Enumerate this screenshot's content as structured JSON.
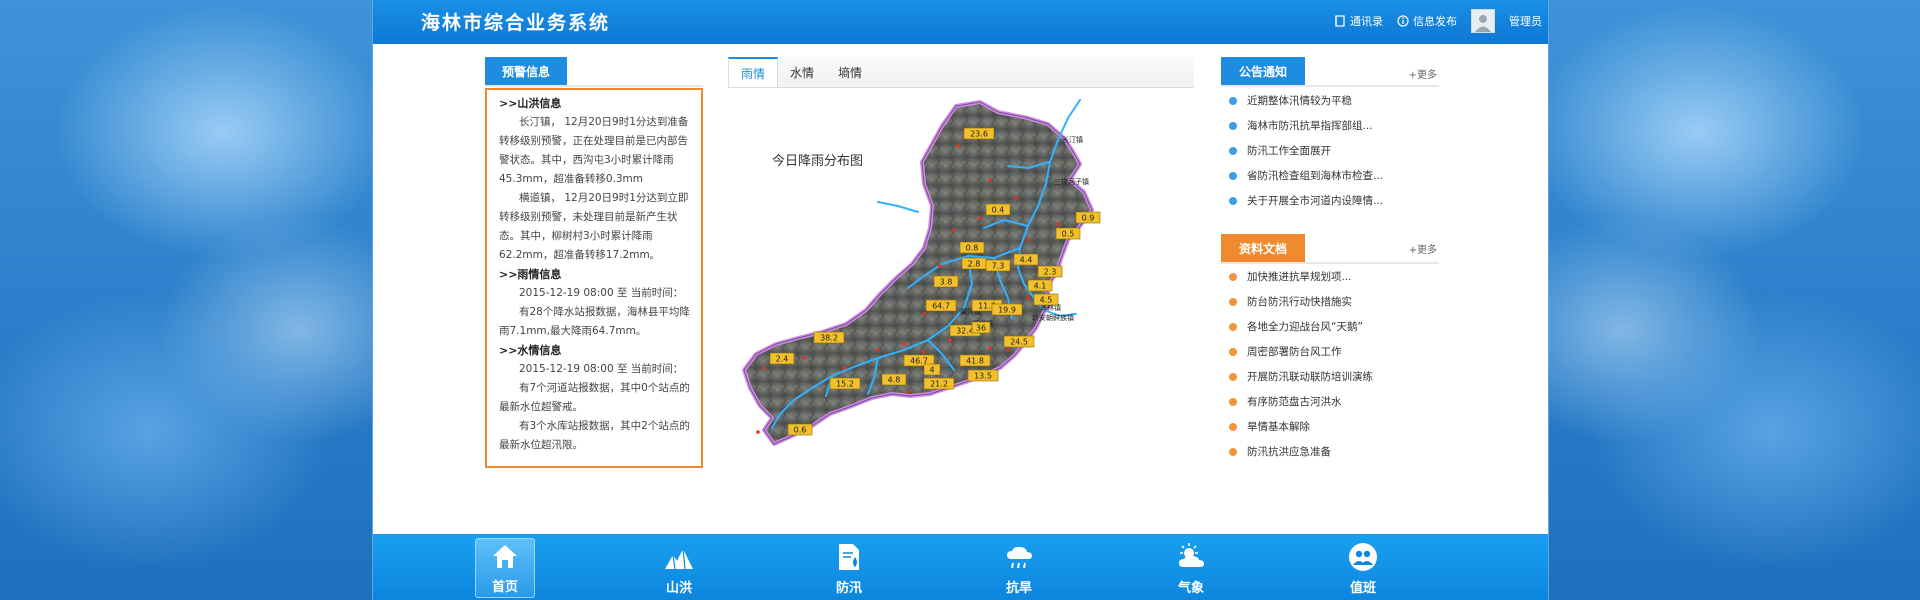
{
  "app": {
    "title": "海林市综合业务系统"
  },
  "header": {
    "contacts_label": "通讯录",
    "publish_label": "信息发布",
    "user_label": "管理员"
  },
  "warning": {
    "tab_label": "预警信息",
    "flood_heading": ">>山洪信息",
    "flood_p1": "长汀镇， 12月20日9时1分达到准备转移级别预警，正在处理目前是已内部告警状态。其中，西沟屯3小时累计降雨45.3mm，超准备转移0.3mm",
    "flood_p2": "横道镇， 12月20日9时1分达到立即转移级别预警，未处理目前是新产生状态。其中，柳树村3小时累计降雨62.2mm，超准备转移17.2mm。",
    "rain_heading": ">>雨情信息",
    "rain_p1": "2015-12-19 08:00 至 当前时间：",
    "rain_p2": "有28个降水站报数据，海林县平均降雨7.1mm,最大降雨64.7mm。",
    "water_heading": ">>水情信息",
    "water_p1": "2015-12-19 08:00 至 当前时间：",
    "water_p2": "有7个河道站报数据，其中0个站点的最新水位超警戒。",
    "water_p3": "有3个水库站报数据，其中2个站点的最新水位超汛限。"
  },
  "map": {
    "tabs": [
      "雨情",
      "水情",
      "墒情"
    ],
    "caption": "今日降雨分布图",
    "rain_labels": [
      {
        "value": "23.6"
      },
      {
        "value": "0.4"
      },
      {
        "value": "0.9"
      },
      {
        "value": "0.5"
      },
      {
        "value": "0.8"
      },
      {
        "value": "2.8"
      },
      {
        "value": "7.3"
      },
      {
        "value": "4.4"
      },
      {
        "value": "2.3"
      },
      {
        "value": "4.1"
      },
      {
        "value": "4.5"
      },
      {
        "value": "3.8"
      },
      {
        "value": "64.7"
      },
      {
        "value": "11.2"
      },
      {
        "value": "19.9"
      },
      {
        "value": "32.4"
      },
      {
        "value": "36"
      },
      {
        "value": "38.2"
      },
      {
        "value": "2.4"
      },
      {
        "value": "46.7"
      },
      {
        "value": "41.8"
      },
      {
        "value": "24.5"
      },
      {
        "value": "4"
      },
      {
        "value": "13.5"
      },
      {
        "value": "4.8"
      },
      {
        "value": "21.2"
      },
      {
        "value": "15.2"
      },
      {
        "value": "0.6"
      }
    ],
    "place_labels": [
      "长汀镇",
      "三道河子镇",
      "柴河镇",
      "海林镇",
      "横道镇",
      "新安朝鲜族镇"
    ]
  },
  "notice": {
    "tab_label": "公告通知",
    "more_label": "+更多",
    "items": [
      "近期整体汛情较为平稳",
      "海林市防汛抗旱指挥部组...",
      "防汛工作全面展开",
      "省防汛检查组到海林市检查...",
      "关于开展全市河道内设障情..."
    ]
  },
  "docs": {
    "tab_label": "资料文档",
    "more_label": "+更多",
    "items": [
      "加快推进抗旱规划项...",
      "防台防汛行动快措施实",
      "各地全力迎战台风“天鹅”",
      "周密部署防台风工作",
      "开展防汛联动联防培训演练",
      "有序防范盘古河洪水",
      "旱情基本解除",
      "防汛抗洪应急准备"
    ]
  },
  "nav": {
    "items": [
      "首页",
      "山洪",
      "防汛",
      "抗旱",
      "气象",
      "值班"
    ]
  },
  "colors": {
    "primary": "#1e8de0",
    "accent_orange": "#f08a2e",
    "header_blue": "#0d78d6",
    "nav_blue": "#0d86de",
    "rain_label_bg": "#f2c02a"
  }
}
